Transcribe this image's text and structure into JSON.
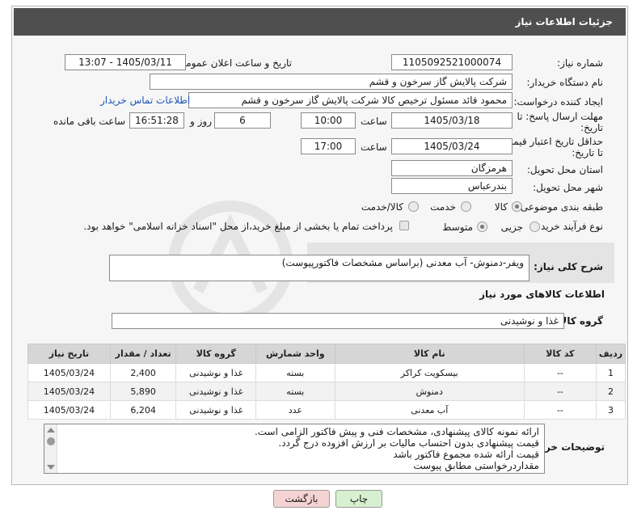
{
  "header": {
    "title": "جزئیات اطلاعات نیاز"
  },
  "fields": {
    "need_number_label": "شماره نیاز:",
    "need_number": "1105092521000074",
    "announce_label": "تاریخ و ساعت اعلان عمومی:",
    "announce_value": "1405/03/11 - 13:07",
    "buyer_org_label": "نام دستگاه خریدار:",
    "buyer_org": "شرکت پالایش گاز سرخون و قشم",
    "requester_label": "ایجاد کننده درخواست:",
    "requester": "محمود قائد مسئول ترخیص کالا شرکت پالایش گاز سرخون و قشم",
    "buyer_contact_link": "اطلاعات تماس خریدار",
    "deadline_label_1": "مهلت ارسال پاسخ: تا",
    "deadline_label_2": "تاریخ:",
    "deadline_date": "1405/03/18",
    "time_label": "ساعت",
    "deadline_time": "10:00",
    "days_value": "6",
    "days_label": "روز و",
    "remaining_time": "16:51:28",
    "remaining_label": "ساعت باقی مانده",
    "validity_label_1": "حداقل تاریخ اعتبار قیمت:",
    "validity_label_2": "تا تاریخ:",
    "validity_date": "1405/03/24",
    "validity_time": "17:00",
    "province_label": "استان محل تحویل:",
    "province": "هرمزگان",
    "city_label": "شهر محل تحویل:",
    "city": "بندرعباس",
    "category_label": "طبقه بندی موضوعی:",
    "category_options": [
      "کالا",
      "خدمت",
      "کالا/خدمت"
    ],
    "process_label": "نوع فرآیند خرید :",
    "process_options": [
      "جزیی",
      "متوسط"
    ],
    "payment_note": "پرداخت تمام یا بخشی از مبلغ خرید،از محل \"اسناد خزانه اسلامی\" خواهد بود."
  },
  "description": {
    "label": "شرح کلی نیاز:",
    "value": "ویفر-دمنوش- آب معدنی (براساس مشخصات فاکتورپیوست)"
  },
  "goods": {
    "section_title": "اطلاعات کالاهای مورد نیاز",
    "group_label": "گروه کالا:",
    "group_value": "غذا و نوشیدنی",
    "columns": [
      "ردیف",
      "کد کالا",
      "نام کالا",
      "واحد شمارش",
      "گروه کالا",
      "تعداد / مقدار",
      "تاریخ نیاز"
    ],
    "rows": [
      {
        "idx": "1",
        "code": "--",
        "name": "بیسکویت کراکر",
        "unit": "بسته",
        "group": "غذا و نوشیدنی",
        "qty": "2,400",
        "date": "1405/03/24"
      },
      {
        "idx": "2",
        "code": "--",
        "name": "دمنوش",
        "unit": "بسته",
        "group": "غذا و نوشیدنی",
        "qty": "5,890",
        "date": "1405/03/24"
      },
      {
        "idx": "3",
        "code": "--",
        "name": "آب معدنی",
        "unit": "عدد",
        "group": "غذا و نوشیدنی",
        "qty": "6,204",
        "date": "1405/03/24"
      }
    ]
  },
  "buyer_notes": {
    "label": "توضیحات خریدار:",
    "lines": [
      "ارائه نمونه کالای پیشنهادی، مشخصات فنی و پیش فاکتور الزامی است.",
      "قیمت پیشنهادی بدون احتساب مالیات بر ارزش افزوده درج گردد.",
      "قیمت ارائه شده مجموع فاکتور باشد",
      "مقداردرخواستی مطابق پیوست"
    ]
  },
  "buttons": {
    "print": "چاپ",
    "back": "بازگشت"
  },
  "colors": {
    "header_bg": "#4f4f4f",
    "link": "#1a55b8",
    "back_button": "#f6d3d3",
    "print_button": "#d6f0d0"
  }
}
